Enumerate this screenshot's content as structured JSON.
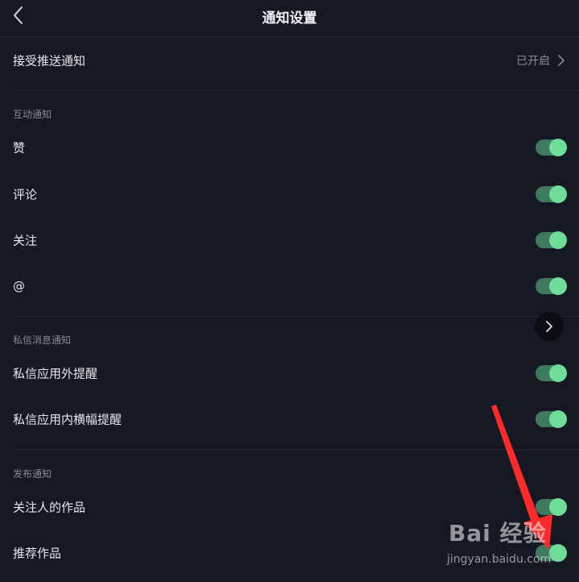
{
  "header": {
    "title": "通知设置"
  },
  "push": {
    "label": "接受推送通知",
    "value": "已开启"
  },
  "sections": {
    "interaction": {
      "title": "互动通知",
      "items": [
        {
          "label": "赞",
          "enabled": true
        },
        {
          "label": "评论",
          "enabled": true
        },
        {
          "label": "关注",
          "enabled": true
        },
        {
          "label": "@",
          "enabled": true
        }
      ]
    },
    "messages": {
      "title": "私信消息通知",
      "items": [
        {
          "label": "私信应用外提醒",
          "enabled": true
        },
        {
          "label": "私信应用内横幅提醒",
          "enabled": true
        }
      ]
    },
    "publish": {
      "title": "发布通知",
      "items": [
        {
          "label": "关注人的作品",
          "enabled": true
        },
        {
          "label": "推荐作品",
          "enabled": true
        }
      ]
    }
  },
  "watermark": {
    "logo": "Bai 经验",
    "url": "jingyan.baidu.com"
  },
  "colors": {
    "background": "#161823",
    "toggle_track": "#3f7a5e",
    "toggle_knob": "#6fdc9a",
    "annotation_arrow": "#ff2a2a"
  }
}
